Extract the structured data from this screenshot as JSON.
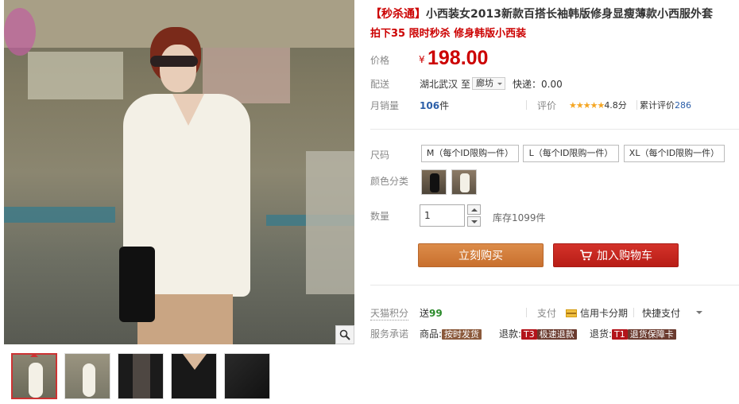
{
  "product": {
    "title_bracket": "【秒杀通】",
    "title_main": "小西装女2013新款百搭长袖韩版修身显瘦薄款小西服外套",
    "subtitle": "拍下35 限时秒杀 修身韩版小西装"
  },
  "price": {
    "label": "价格",
    "currency": "¥",
    "value": "198.00"
  },
  "shipping": {
    "label": "配送",
    "from": "湖北武汉",
    "to_word": "至",
    "dest": "廊坊",
    "fee": "快递：0.00"
  },
  "sales": {
    "label": "月销量",
    "count": "106",
    "unit": "件",
    "rating_label": "评价",
    "stars": "★★★★★",
    "score": "4.8分",
    "review_label": "累计评价",
    "review_count": "286"
  },
  "sizes": {
    "label": "尺码",
    "options": [
      "M（每个ID限购一件）",
      "L（每个ID限购一件）",
      "XL（每个ID限购一件）"
    ]
  },
  "colors": {
    "label": "颜色分类"
  },
  "quantity": {
    "label": "数量",
    "value": "1",
    "stock": "库存1099件"
  },
  "buttons": {
    "buy": "立刻购买",
    "cart": "加入购物车"
  },
  "points": {
    "label": "天猫积分",
    "send": "送",
    "value": "99",
    "pay_label": "支付",
    "card_pay": "信用卡分期",
    "quick_pay": "快捷支付"
  },
  "service": {
    "label": "服务承诺",
    "goods_label": "商品:",
    "goods_tag": "按时发货",
    "refund_label": "退款:",
    "refund_code": "T3",
    "refund_tag": "极速退款",
    "return_label": "退货:",
    "return_code": "T1",
    "return_tag": "退货保障卡"
  },
  "icons": [
    "zoom-icon",
    "cart-icon",
    "credit-card-icon",
    "chevron-down-icon"
  ],
  "colors_theme": {
    "price_red": "#cc0000",
    "buy_orange": "#c8702e",
    "cart_red": "#b81d16",
    "link_blue": "#2b5ea8"
  }
}
